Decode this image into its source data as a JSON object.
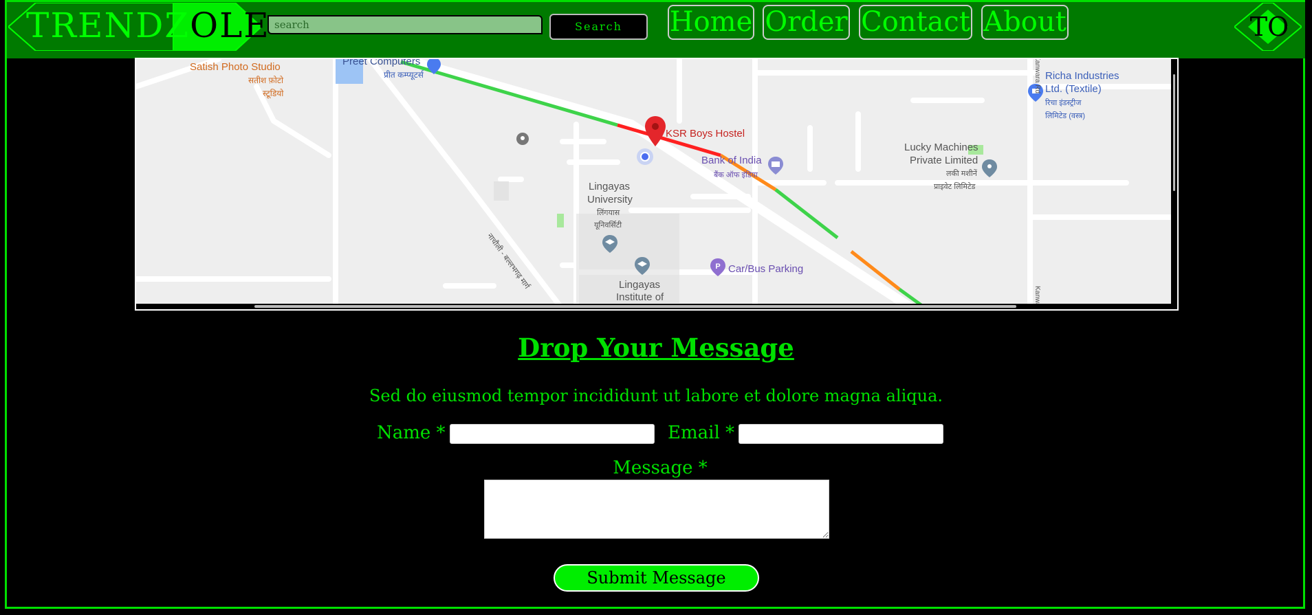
{
  "header": {
    "logo": {
      "text_a": "TRENDZ",
      "text_b": "OLE"
    },
    "search": {
      "placeholder": "search",
      "button_label": "Search"
    },
    "nav": [
      {
        "label": "Home"
      },
      {
        "label": "Order"
      },
      {
        "label": "Contact"
      },
      {
        "label": "About"
      }
    ],
    "top_button_label": "TO"
  },
  "map": {
    "labels": {
      "satish_en": "Satish Photo Studio",
      "satish_hi1": "सतीश फ़ोटो",
      "satish_hi2": "स्टूडियो",
      "preet_en": "Preet Computers",
      "preet_hi": "प्रीत कम्प्यूटर्स",
      "hostel": "KSR Boys Hostel",
      "bank_en": "Bank of India",
      "bank_hi": "बैंक ऑफ इंडिया",
      "lingayas_uni1": "Lingayas",
      "lingayas_uni2": "University",
      "lingayas_uni_hi1": "लिंगयास",
      "lingayas_uni_hi2": "यूनिवर्सिटी",
      "lingayas_inst1": "Lingayas",
      "lingayas_inst2": "Institute of",
      "road_hi": "नाचौली - बल्लभगढ़ मार्ग",
      "carbus": "Car/Bus Parking",
      "lucky_en1": "Lucky Machines",
      "lucky_en2": "Private Limited",
      "lucky_hi1": "लकी मशीनें",
      "lucky_hi2": "प्राइवेट लिमिटेड",
      "richa_en1": "Richa Industries",
      "richa_en2": "Ltd. (Textile)",
      "richa_hi1": "रिचा इंडस्ट्रीज",
      "richa_hi2": "लिमिटेड (वस्त्र)",
      "kanwara_rd": "Kanwara Rd",
      "kanwara_rd2": "Kanwara"
    }
  },
  "contact": {
    "title": "Drop Your Message",
    "subtitle": "Sed do eiusmod tempor incididunt ut labore et dolore magna aliqua.",
    "name_label": "Name *",
    "email_label": "Email *",
    "message_label": "Message *",
    "submit_label": "Submit Message"
  },
  "colors": {
    "accent": "#00e000",
    "header_bg": "#007a00",
    "page_bg": "#000000"
  }
}
